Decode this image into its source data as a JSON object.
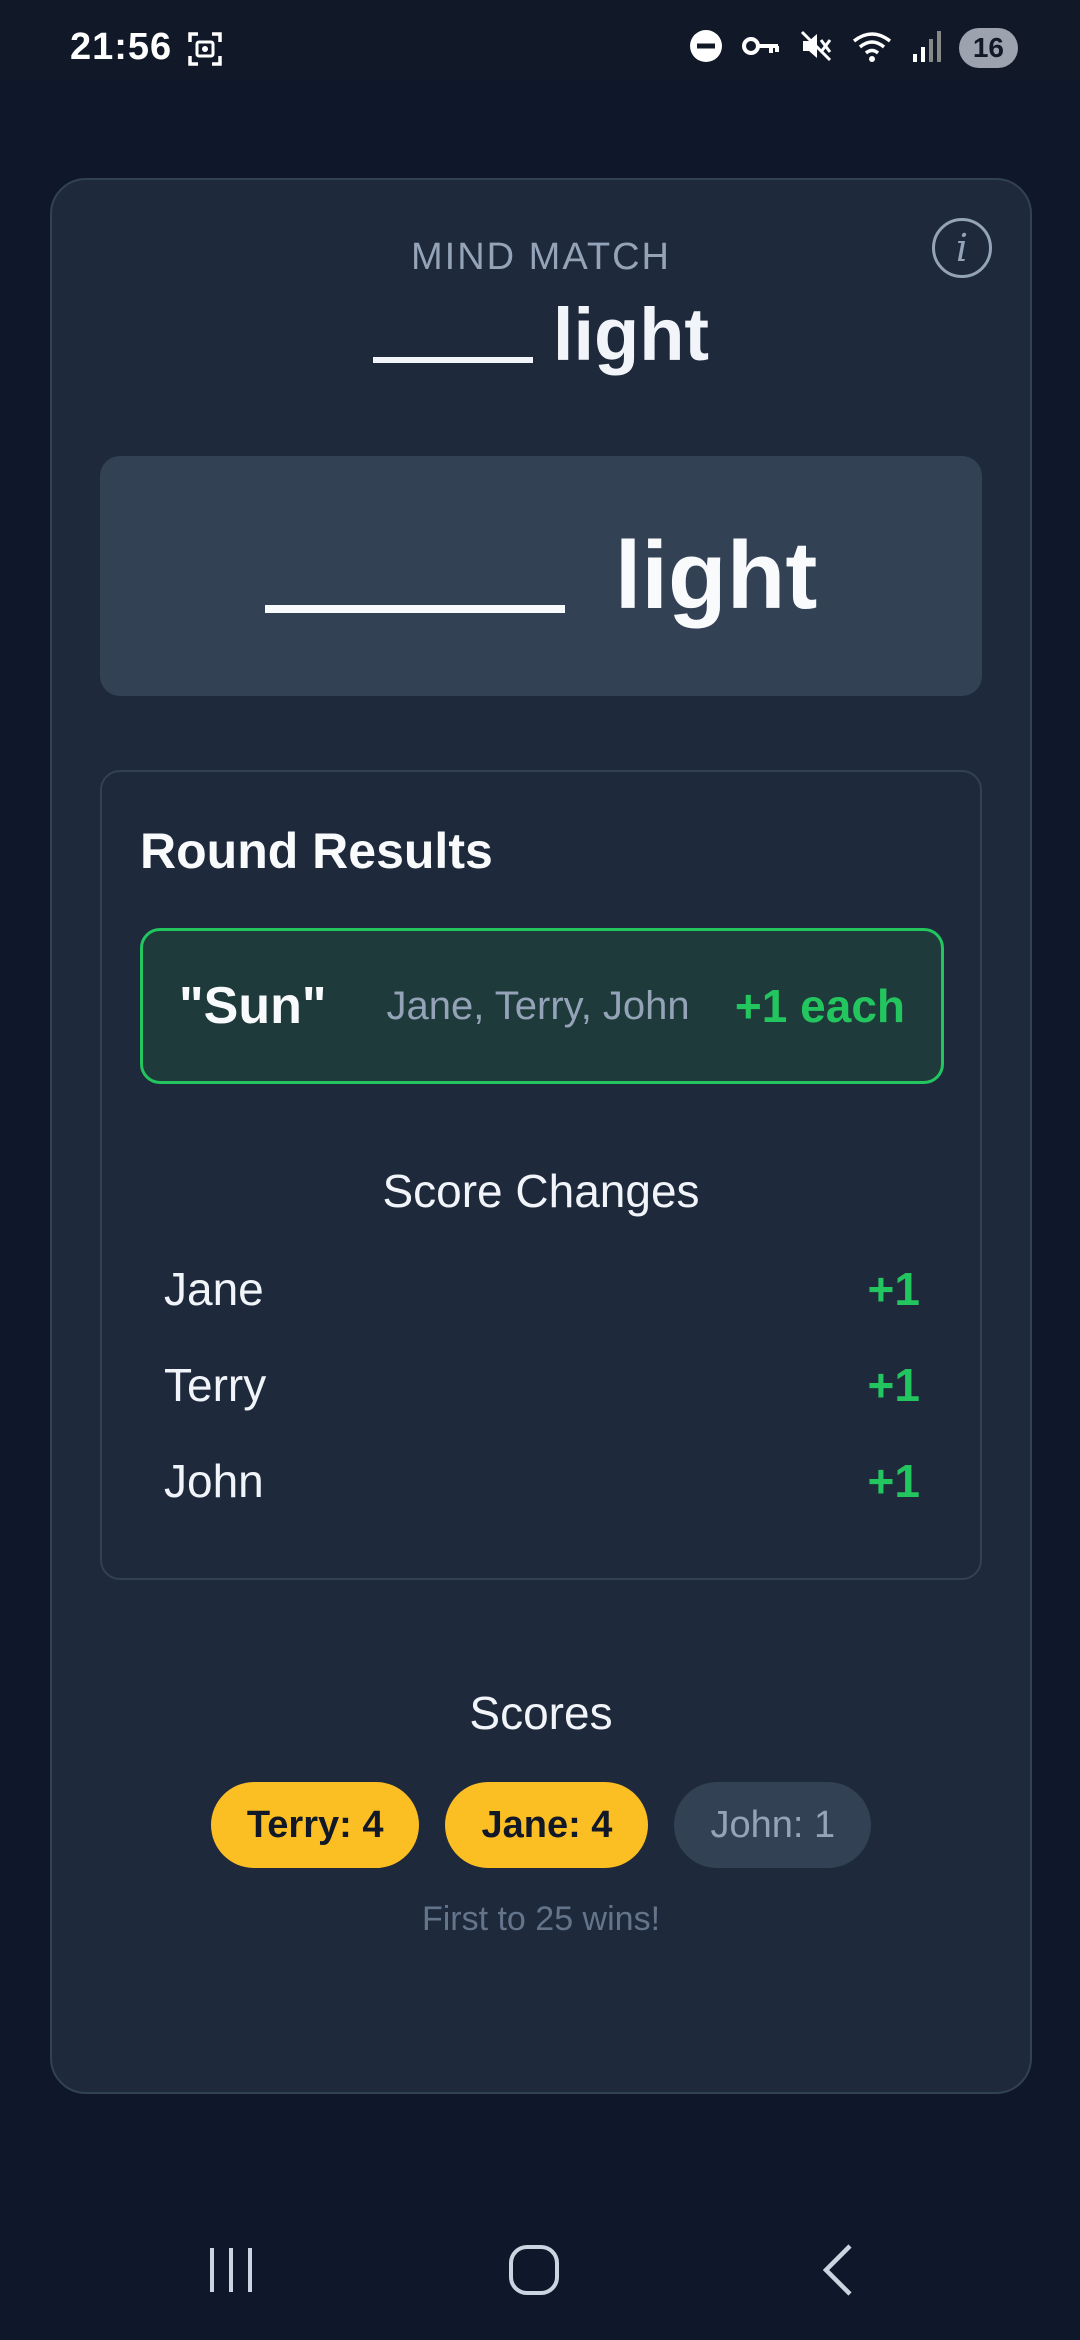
{
  "status_bar": {
    "time": "21:56",
    "battery": "16",
    "icons": [
      "screenshot-icon",
      "do-not-disturb-icon",
      "vpn-key-icon",
      "mute-icon",
      "wifi-icon",
      "signal-icon"
    ]
  },
  "game": {
    "label": "MIND MATCH",
    "prompt_word": "light",
    "info_icon": "i"
  },
  "results": {
    "title": "Round Results",
    "match": {
      "word": "\"Sun\"",
      "players": "Jane, Terry, John",
      "points": "+1 each"
    },
    "changes_title": "Score Changes",
    "changes": [
      {
        "name": "Jane",
        "points": "+1"
      },
      {
        "name": "Terry",
        "points": "+1"
      },
      {
        "name": "John",
        "points": "+1"
      }
    ]
  },
  "scores": {
    "title": "Scores",
    "pills": [
      {
        "label": "Terry: 4",
        "leader": true
      },
      {
        "label": "Jane: 4",
        "leader": true
      },
      {
        "label": "John: 1",
        "leader": false
      }
    ],
    "note": "First to 25 wins!"
  },
  "colors": {
    "background": "#0f172a",
    "card": "#1e293b",
    "accent_green": "#22c55e",
    "leader_gold": "#fbbf24"
  }
}
